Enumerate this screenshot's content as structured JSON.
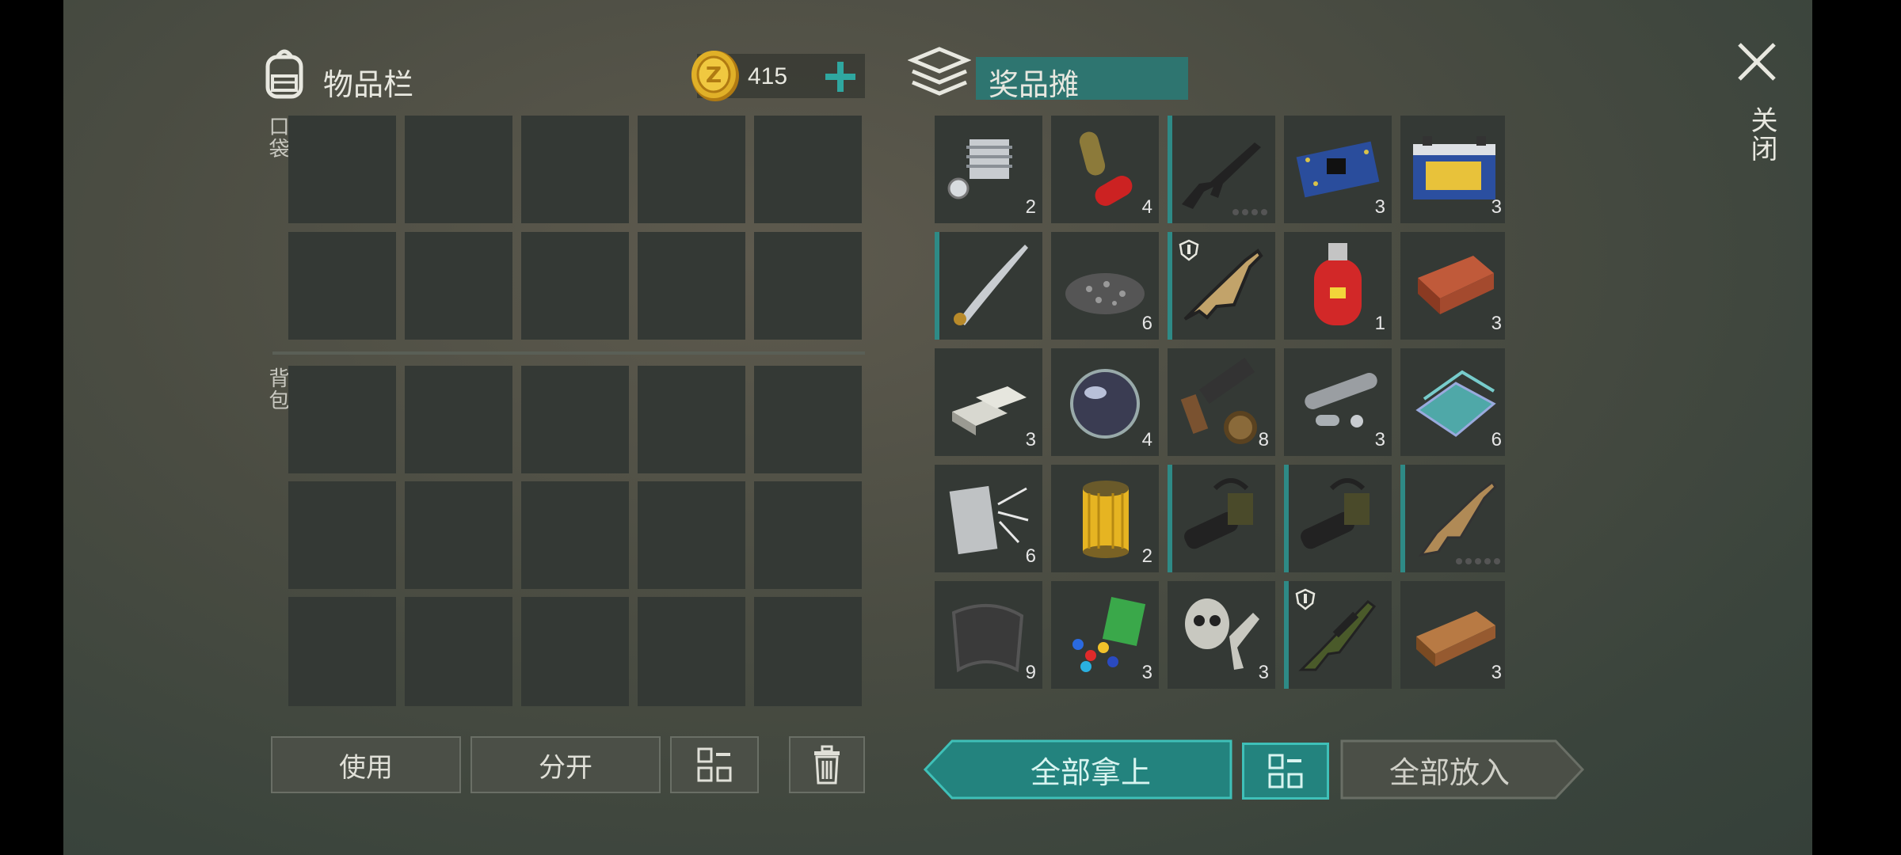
{
  "inventory": {
    "title": "物品栏",
    "icon": "backpack-icon",
    "coins": "415",
    "pocket_label": "口袋",
    "backpack_label": "背包"
  },
  "loot": {
    "title": "奖品摊",
    "icon": "stack-icon",
    "close_label": "关闭",
    "items": [
      {
        "name": "engine-cylinder-icon",
        "count": "2"
      },
      {
        "name": "pills-icon",
        "count": "4"
      },
      {
        "name": "assault-rifle-icon",
        "count": ""
      },
      {
        "name": "circuit-board-icon",
        "count": "3"
      },
      {
        "name": "car-battery-icon",
        "count": "3"
      },
      {
        "name": "katana-icon",
        "count": ""
      },
      {
        "name": "gravel-pile-icon",
        "count": "6"
      },
      {
        "name": "bullpup-rifle-icon",
        "count": ""
      },
      {
        "name": "gas-cylinder-icon",
        "count": "1"
      },
      {
        "name": "brick-icon",
        "count": "3"
      },
      {
        "name": "metal-ingots-icon",
        "count": "3"
      },
      {
        "name": "glass-lens-icon",
        "count": "4"
      },
      {
        "name": "weapon-parts-icon",
        "count": "8"
      },
      {
        "name": "pipe-parts-icon",
        "count": "3"
      },
      {
        "name": "glass-sheets-icon",
        "count": "6"
      },
      {
        "name": "fabric-fibers-icon",
        "count": "6"
      },
      {
        "name": "oil-filter-icon",
        "count": "2"
      },
      {
        "name": "minigun-icon",
        "count": ""
      },
      {
        "name": "minigun-icon",
        "count": ""
      },
      {
        "name": "scar-rifle-icon",
        "count": ""
      },
      {
        "name": "carbon-fabric-icon",
        "count": "9"
      },
      {
        "name": "plastic-parts-icon",
        "count": "3"
      },
      {
        "name": "gas-mask-parts-icon",
        "count": "3"
      },
      {
        "name": "sniper-rifle-icon",
        "count": ""
      },
      {
        "name": "wood-plank-icon",
        "count": "3"
      }
    ]
  },
  "buttons": {
    "use": "使用",
    "split": "分开",
    "take_all": "全部拿上",
    "put_all": "全部放入"
  },
  "colors": {
    "accent": "#2e8a86",
    "slot": "#343935",
    "coin": "#e0b028"
  }
}
